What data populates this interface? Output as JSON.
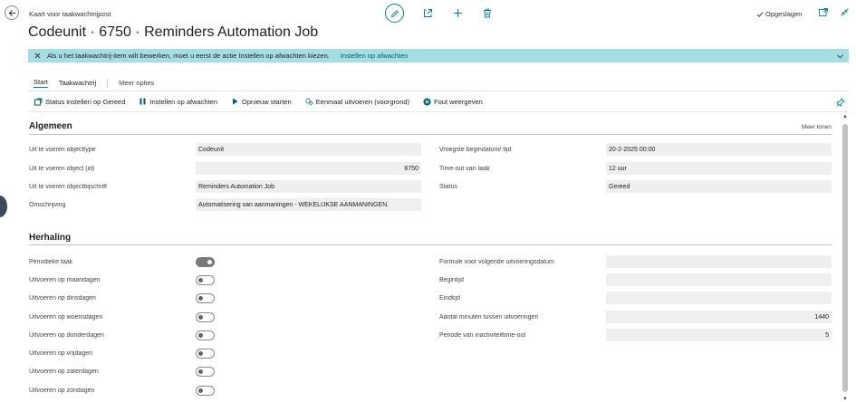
{
  "header": {
    "breadcrumb": "Kaart voor taakwachtrijpost",
    "title": "Codeunit · 6750 · Reminders Automation Job",
    "saved_status": "Opgeslagen"
  },
  "banner": {
    "message": "Als u het taakwachtrij-item wilt bewerken, moet u eerst de actie Instellen op afwachten kiezen.",
    "action_link": "Instellen op afwachten"
  },
  "tabs": [
    {
      "label": "Start",
      "active": true
    },
    {
      "label": "Taakwachtrij",
      "active": false
    },
    {
      "label": "Meer opties",
      "active": false
    }
  ],
  "actions": [
    {
      "label": "Status instellen op Gereed",
      "icon": "status-ready-icon"
    },
    {
      "label": "Instellen op afwachten",
      "icon": "pause-icon"
    },
    {
      "label": "Opnieuw starten",
      "icon": "play-icon"
    },
    {
      "label": "Eenmaal uitvoeren (voorgrond)",
      "icon": "run-once-icon"
    },
    {
      "label": "Fout weergeven",
      "icon": "error-icon"
    }
  ],
  "general": {
    "heading": "Algemeen",
    "show_more": "Meer tonen",
    "left_fields": [
      {
        "label": "Uit te voeren objecttype",
        "value": "Codeunit",
        "numeric": false
      },
      {
        "label": "Uit te voeren object (id)",
        "value": "6750",
        "numeric": true
      },
      {
        "label": "Uit te voeren objectbijschrift",
        "value": "Reminders Automation Job",
        "numeric": false
      },
      {
        "label": "Omschrijving",
        "value": "Automatisering van aanmaningen - WEKELIJKSE AANMANINGEN.",
        "numeric": false
      }
    ],
    "right_fields": [
      {
        "label": "Vroegste begindatum/-tijd",
        "value": "20-2-2025 00:00",
        "numeric": false
      },
      {
        "label": "Time-out van taak",
        "value": "12 uur",
        "numeric": false
      },
      {
        "label": "Status",
        "value": "Gereed",
        "numeric": false
      }
    ]
  },
  "recurrence": {
    "heading": "Herhaling",
    "toggles": [
      {
        "label": "Periodieke taak",
        "on": true
      },
      {
        "label": "Uitvoeren op maandagen",
        "on": false
      },
      {
        "label": "Uitvoeren op dinsdagen",
        "on": false
      },
      {
        "label": "Uitvoeren op woensdagen",
        "on": false
      },
      {
        "label": "Uitvoeren op donderdagen",
        "on": false
      },
      {
        "label": "Uitvoeren op vrijdagen",
        "on": false
      },
      {
        "label": "Uitvoeren op zaterdagen",
        "on": false
      },
      {
        "label": "Uitvoeren op zondagen",
        "on": false
      }
    ],
    "right_fields": [
      {
        "label": "Formule voor volgende uitvoeringsdatum",
        "value": "",
        "numeric": false
      },
      {
        "label": "Begintijd",
        "value": "",
        "numeric": false
      },
      {
        "label": "Eindtijd",
        "value": "",
        "numeric": false
      },
      {
        "label": "Aantal minuten tussen uitvoeringen",
        "value": "1440",
        "numeric": true
      },
      {
        "label": "Periode van inactiviteittime-out",
        "value": "5",
        "numeric": true
      }
    ]
  },
  "colors": {
    "accent": "#00838f",
    "banner_bg": "#a4dde4",
    "field_bg": "#efefef"
  }
}
